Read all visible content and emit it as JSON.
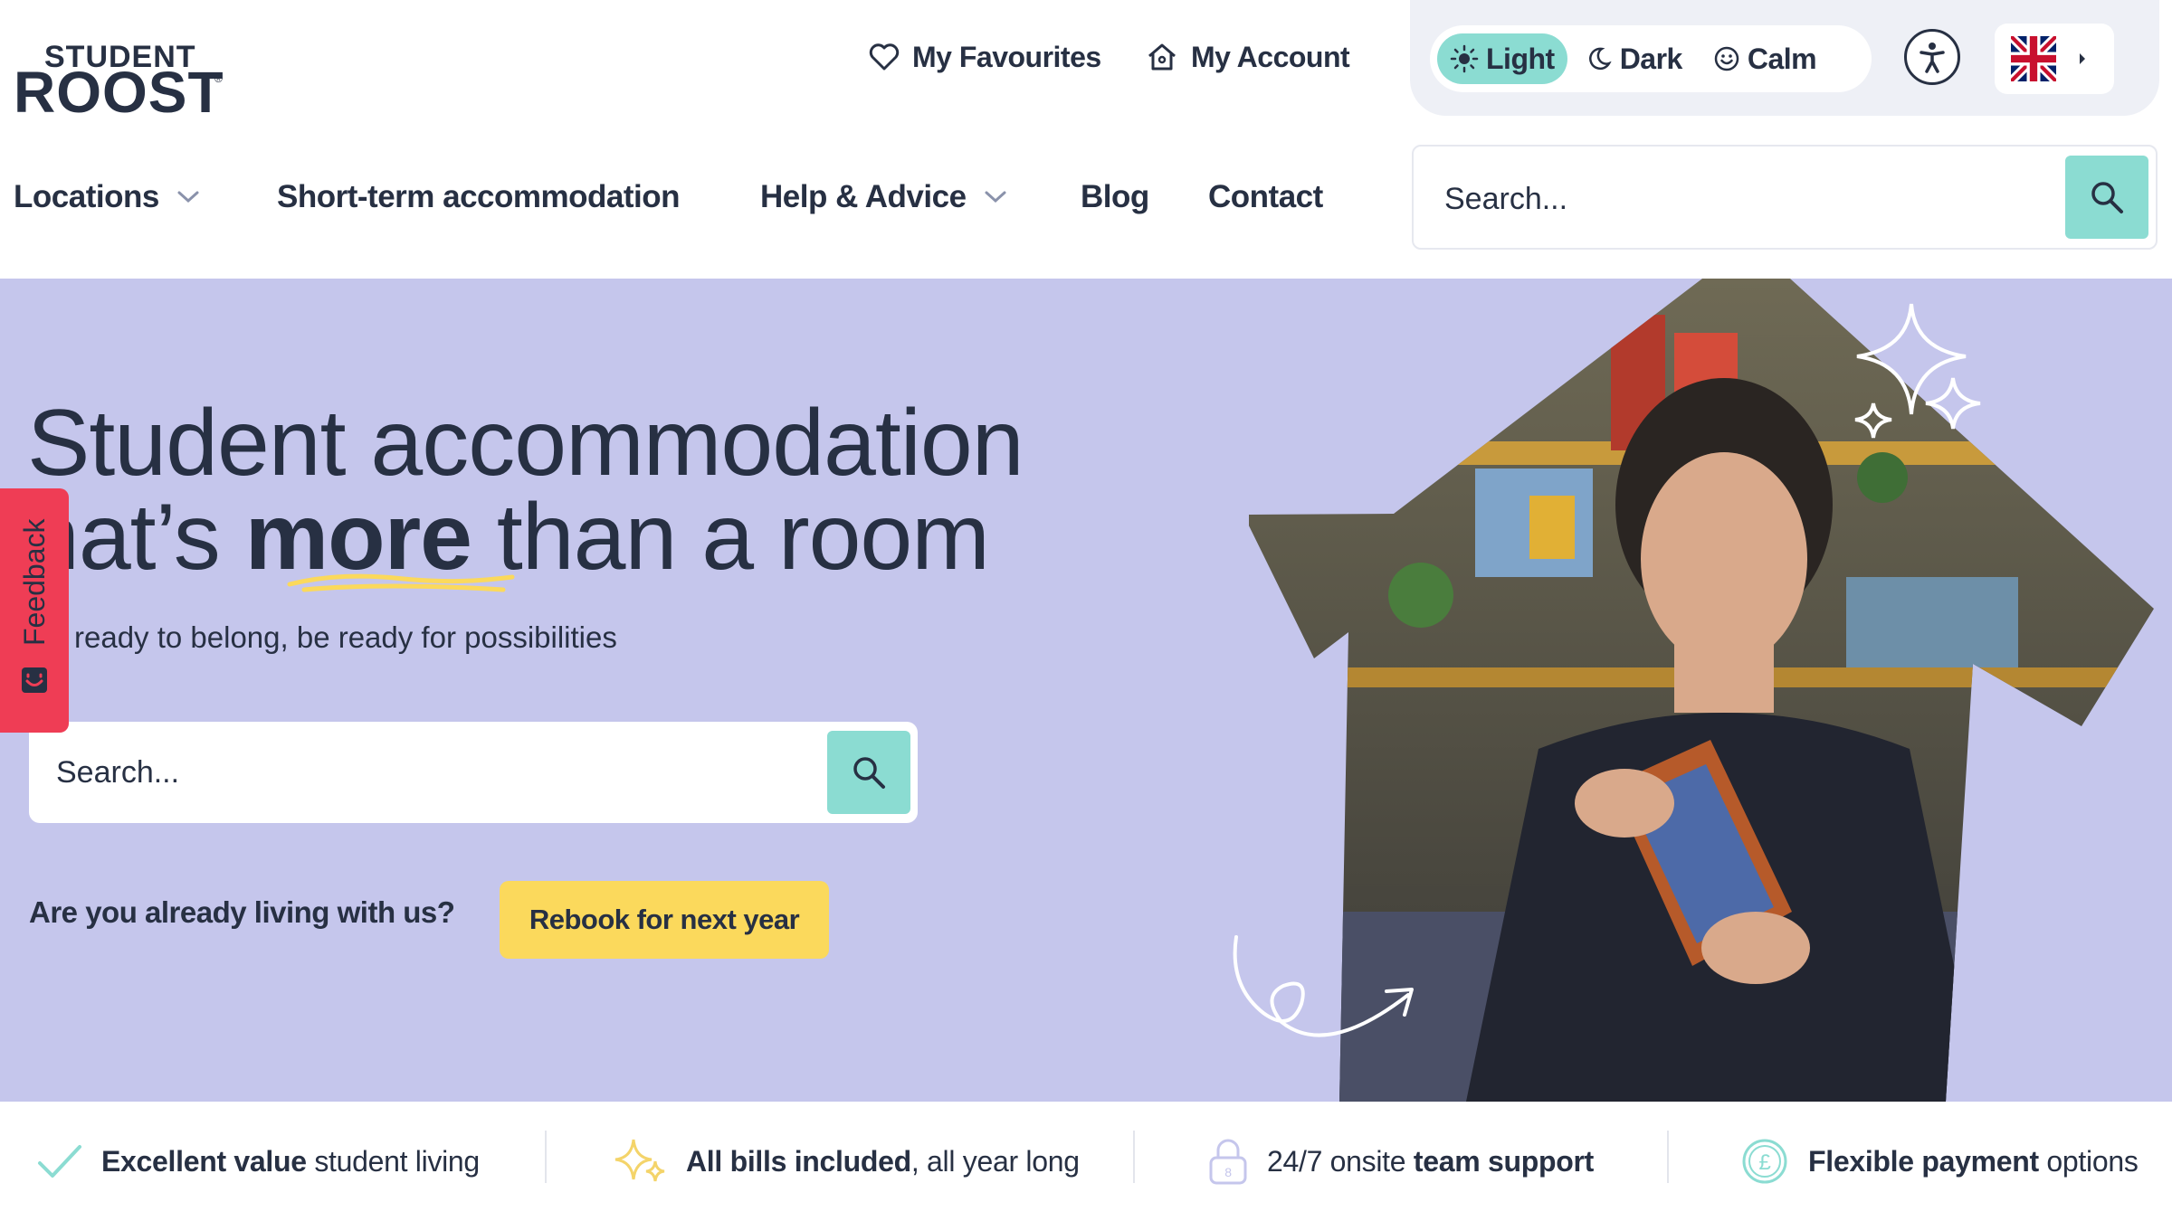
{
  "brand": {
    "top": "STUDENT",
    "main": "ROOST",
    "reg": "®"
  },
  "utility": {
    "favourites": "My Favourites",
    "account": "My Account"
  },
  "theme": {
    "options": [
      "Light",
      "Dark",
      "Calm"
    ],
    "active": "Light"
  },
  "nav": {
    "items": [
      "Locations",
      "Short-term accommodation",
      "Help & Advice",
      "Blog",
      "Contact"
    ]
  },
  "header_search": {
    "placeholder": "Search..."
  },
  "hero": {
    "title_line1": "Student accommodation",
    "title_line2_pre": "hat’s ",
    "title_line2_strong": "more",
    "title_line2_post": " than a room",
    "subtitle": "ready to belong, be ready for possibilities",
    "search_placeholder": "Search...",
    "rebook_question": "Are you already living with us?",
    "rebook_button": "Rebook for next year"
  },
  "feedback": {
    "label": "Feedback"
  },
  "benefits": [
    {
      "strong": "Excellent value",
      "rest": " student living",
      "icon": "check-icon"
    },
    {
      "strong": "All bills included",
      "rest": ", all year long",
      "icon": "sparkle-icon"
    },
    {
      "pre": "24/7 onsite ",
      "strong": "team support",
      "icon": "lock-icon"
    },
    {
      "strong": "Flexible payment",
      "rest": " options",
      "icon": "pound-coin-icon"
    }
  ],
  "colors": {
    "ink": "#273043",
    "hero_bg": "#c5c6ec",
    "teal": "#8bdcd2",
    "yellow": "#fbd95c",
    "feedback_red": "#ef3d55"
  }
}
